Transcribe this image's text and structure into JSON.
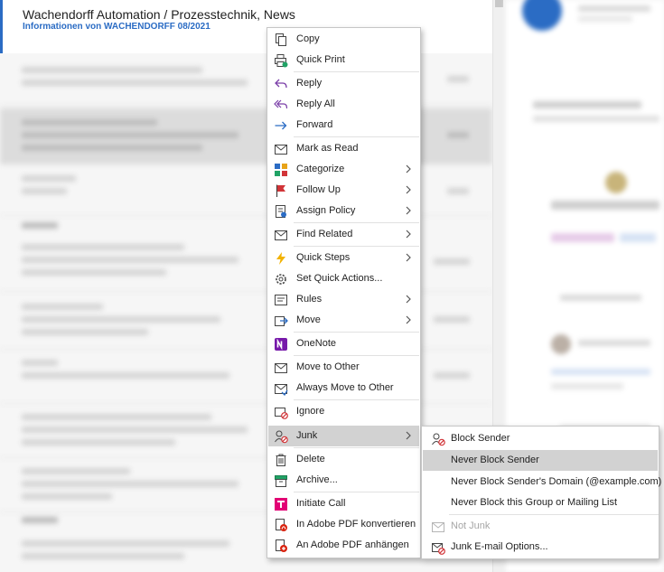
{
  "email_list": {
    "first_email": {
      "sender": "Wachendorff Automation / Prozesstechnik, News",
      "subject": "Informationen von WACHENDORFF 08/2021"
    }
  },
  "context_menu": {
    "items": [
      {
        "label": "Copy",
        "icon": "copy-icon",
        "submenu": false
      },
      {
        "label": "Quick Print",
        "icon": "quick-print-icon",
        "submenu": false
      },
      {
        "label": "Reply",
        "icon": "reply-icon",
        "submenu": false
      },
      {
        "label": "Reply All",
        "icon": "reply-all-icon",
        "submenu": false
      },
      {
        "label": "Forward",
        "icon": "forward-icon",
        "submenu": false
      },
      {
        "label": "Mark as Read",
        "icon": "mark-as-read-icon",
        "submenu": false
      },
      {
        "label": "Categorize",
        "icon": "categorize-icon",
        "submenu": true
      },
      {
        "label": "Follow Up",
        "icon": "follow-up-flag-icon",
        "submenu": true
      },
      {
        "label": "Assign Policy",
        "icon": "assign-policy-icon",
        "submenu": true
      },
      {
        "label": "Find Related",
        "icon": "find-related-icon",
        "submenu": true
      },
      {
        "label": "Quick Steps",
        "icon": "quick-steps-lightning-icon",
        "submenu": true
      },
      {
        "label": "Set Quick Actions...",
        "icon": "settings-gear-icon",
        "submenu": false
      },
      {
        "label": "Rules",
        "icon": "rules-icon",
        "submenu": true
      },
      {
        "label": "Move",
        "icon": "move-icon",
        "submenu": true
      },
      {
        "label": "OneNote",
        "icon": "onenote-icon",
        "submenu": false
      },
      {
        "label": "Move to Other",
        "icon": "move-to-other-icon",
        "submenu": false
      },
      {
        "label": "Always Move to Other",
        "icon": "always-move-to-other-icon",
        "submenu": false
      },
      {
        "label": "Ignore",
        "icon": "ignore-icon",
        "submenu": false
      },
      {
        "label": "Junk",
        "icon": "junk-icon",
        "submenu": true,
        "highlighted": true
      },
      {
        "label": "Delete",
        "icon": "delete-icon",
        "submenu": false
      },
      {
        "label": "Archive...",
        "icon": "archive-icon",
        "submenu": false
      },
      {
        "label": "Initiate Call",
        "icon": "telekom-call-icon",
        "submenu": false
      },
      {
        "label": "In Adobe PDF konvertieren",
        "icon": "adobe-pdf-convert-icon",
        "submenu": false
      },
      {
        "label": "An Adobe PDF anhängen",
        "icon": "adobe-pdf-append-icon",
        "submenu": false
      }
    ]
  },
  "junk_submenu": {
    "items": [
      {
        "label": "Block Sender",
        "icon": "block-sender-icon",
        "enabled": true
      },
      {
        "label": "Never Block Sender",
        "icon": "",
        "enabled": true,
        "highlighted": true
      },
      {
        "label": "Never Block Sender's Domain (@example.com)",
        "icon": "",
        "enabled": true
      },
      {
        "label": "Never Block this Group or Mailing List",
        "icon": "",
        "enabled": true
      },
      {
        "label": "Not Junk",
        "icon": "not-junk-icon",
        "enabled": false
      },
      {
        "label": "Junk E-mail Options...",
        "icon": "junk-options-icon",
        "enabled": true
      }
    ]
  },
  "colors": {
    "accent": "#2b6cc4",
    "highlight": "#d2d2d2",
    "telekom": "#e20074",
    "onenote": "#7719aa"
  }
}
